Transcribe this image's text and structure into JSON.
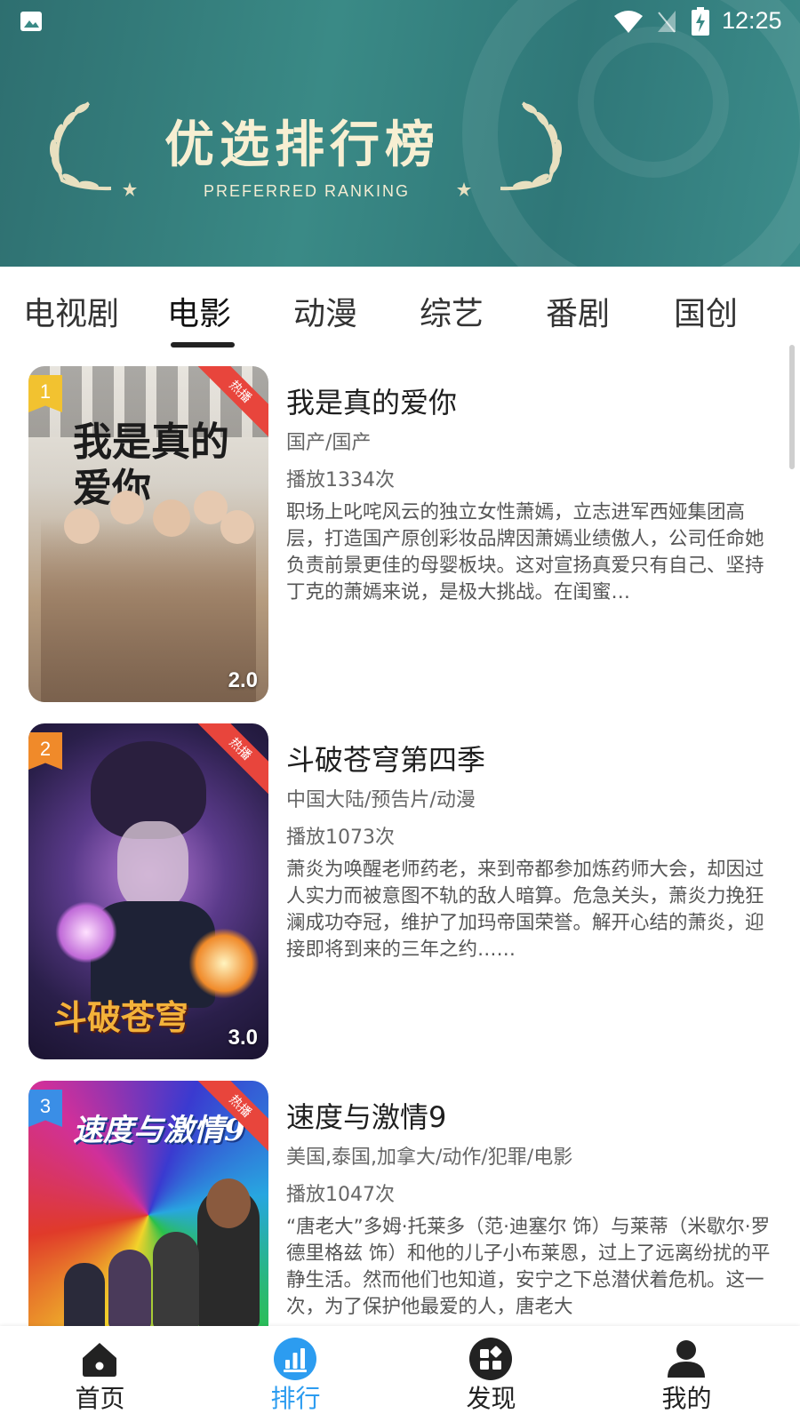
{
  "status_bar": {
    "time": "12:25"
  },
  "banner": {
    "title": "优选排行榜",
    "subtitle": "PREFERRED RANKING"
  },
  "tabs": [
    {
      "label": "电视剧",
      "active": false
    },
    {
      "label": "电影",
      "active": true
    },
    {
      "label": "动漫",
      "active": false
    },
    {
      "label": "综艺",
      "active": false
    },
    {
      "label": "番剧",
      "active": false
    },
    {
      "label": "国创",
      "active": false
    }
  ],
  "items": [
    {
      "rank": "1",
      "rank_color": "#f2c230",
      "hot_label": "热播",
      "score": "2.0",
      "poster_text": "我是真的爱你",
      "title": "我是真的爱你",
      "genre": "国产/国产",
      "plays": "播放1334次",
      "description": "职场上叱咤风云的独立女性萧嫣，立志进军西娅集团高层，打造国产原创彩妆品牌因萧嫣业绩傲人，公司任命她负责前景更佳的母婴板块。这对宣扬真爱只有自己、坚持丁克的萧嫣来说，是极大挑战。在闺蜜…"
    },
    {
      "rank": "2",
      "rank_color": "#f08a2a",
      "hot_label": "热播",
      "score": "3.0",
      "poster_text": "斗破苍穹",
      "title": "斗破苍穹第四季",
      "genre": "中国大陆/预告片/动漫",
      "plays": "播放1073次",
      "description": "萧炎为唤醒老师药老，来到帝都参加炼药师大会，却因过人实力而被意图不轨的敌人暗算。危急关头，萧炎力挽狂澜成功夺冠，维护了加玛帝国荣誉。解开心结的萧炎，迎接即将到来的三年之约……"
    },
    {
      "rank": "3",
      "rank_color": "#3a8ee6",
      "hot_label": "热播",
      "score": "",
      "poster_text": "速度与激情9",
      "title": "速度与激情9",
      "genre": "美国,泰国,加拿大/动作/犯罪/电影",
      "plays": "播放1047次",
      "description": "“唐老大”多姆·托莱多（范·迪塞尔 饰）与莱蒂（米歇尔·罗德里格兹 饰）和他的儿子小布莱恩，过上了远离纷扰的平静生活。然而他们也知道，安宁之下总潜伏着危机。这一次，为了保护他最爱的人，唐老大"
    }
  ],
  "bottom_nav": [
    {
      "label": "首页",
      "icon": "home-icon",
      "active": false
    },
    {
      "label": "排行",
      "icon": "ranking-icon",
      "active": true
    },
    {
      "label": "发现",
      "icon": "discover-icon",
      "active": false
    },
    {
      "label": "我的",
      "icon": "profile-icon",
      "active": false
    }
  ],
  "colors": {
    "accent": "#2c9cf0",
    "hot": "#e8453c",
    "banner": "#2f7778"
  }
}
